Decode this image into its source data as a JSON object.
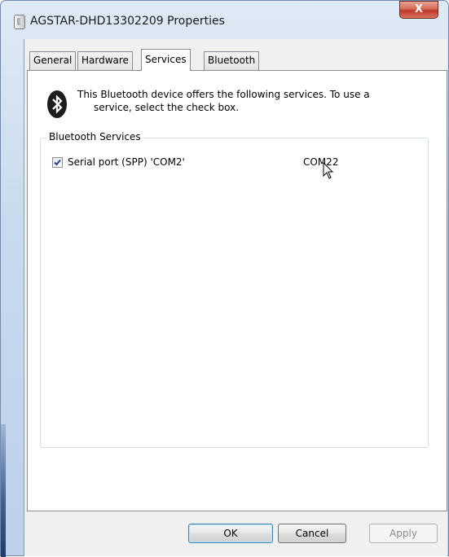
{
  "window": {
    "title": "AGSTAR-DHD13302209 Properties",
    "close_label": "X"
  },
  "tabs": [
    {
      "label": "General",
      "active": false
    },
    {
      "label": "Hardware",
      "active": false
    },
    {
      "label": "Services",
      "active": true
    },
    {
      "label": "Bluetooth",
      "active": false
    }
  ],
  "services_page": {
    "info_line1": "This Bluetooth device offers the following services. To use a",
    "info_line2": "service, select the check box.",
    "group_title": "Bluetooth Services",
    "services": [
      {
        "name": "Serial port (SPP) 'COM2'",
        "port": "COM22",
        "checked": true
      }
    ]
  },
  "buttons": {
    "ok": "OK",
    "cancel": "Cancel",
    "apply": "Apply"
  },
  "colors": {
    "frame": "#c9daee",
    "close_button": "#c0392b",
    "default_button_border": "#3c7fb1"
  },
  "icons": {
    "title": "device-icon",
    "service": "bluetooth-icon",
    "pointer": "arrow-cursor-icon"
  }
}
